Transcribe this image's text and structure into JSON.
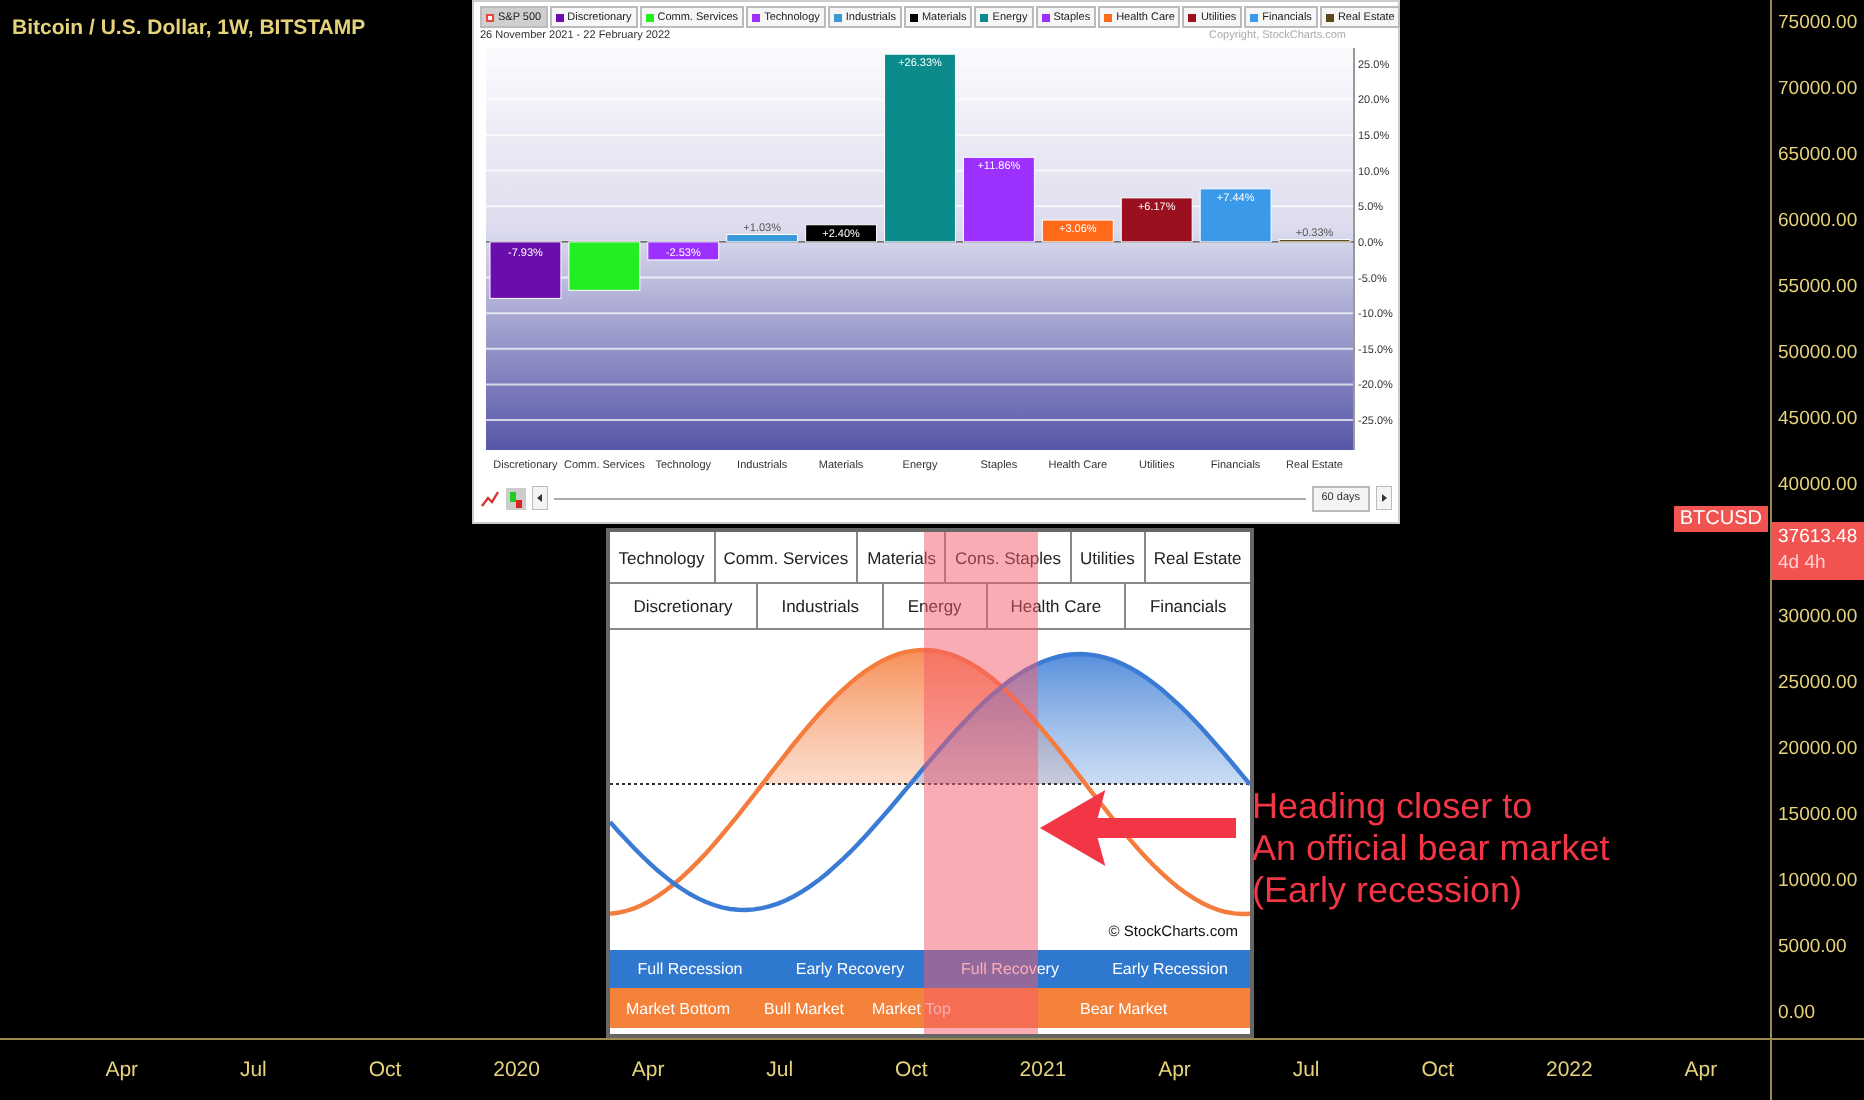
{
  "chart_title": "Bitcoin / U.S. Dollar, 1W, BITSTAMP",
  "sector_performance": {
    "legend": [
      {
        "label": "S&P 500",
        "color": "#e8453c",
        "selected": true
      },
      {
        "label": "Discretionary",
        "color": "#6a0dad",
        "selected": false
      },
      {
        "label": "Comm. Services",
        "color": "#22ee22",
        "selected": false
      },
      {
        "label": "Technology",
        "color": "#9b30ff",
        "selected": false
      },
      {
        "label": "Industrials",
        "color": "#3a9ad9",
        "selected": false
      },
      {
        "label": "Materials",
        "color": "#000000",
        "selected": false
      },
      {
        "label": "Energy",
        "color": "#0b8b8b",
        "selected": false
      },
      {
        "label": "Staples",
        "color": "#9b30ff",
        "selected": false
      },
      {
        "label": "Health Care",
        "color": "#ff6a1a",
        "selected": false
      },
      {
        "label": "Utilities",
        "color": "#9b1020",
        "selected": false
      },
      {
        "label": "Financials",
        "color": "#3a9ae9",
        "selected": false
      },
      {
        "label": "Real Estate",
        "color": "#5a4a1a",
        "selected": false
      }
    ],
    "date_range": "26 November 2021 - 22 February 2022",
    "copyright": "Copyright, StockCharts.com",
    "chart_data": {
      "type": "bar",
      "categories": [
        "Discretionary",
        "Comm. Services",
        "Technology",
        "Industrials",
        "Materials",
        "Energy",
        "Staples",
        "Health Care",
        "Utilities",
        "Financials",
        "Real Estate"
      ],
      "values": [
        -7.93,
        -6.8,
        -2.53,
        1.03,
        2.4,
        26.33,
        11.86,
        3.06,
        6.17,
        7.44,
        0.33
      ],
      "value_labels": [
        "-7.93%",
        null,
        "-2.53%",
        "+1.03%",
        "+2.40%",
        "+26.33%",
        "+11.86%",
        "+3.06%",
        "+6.17%",
        "+7.44%",
        "+0.33%"
      ],
      "ylim": [
        -29.2,
        27.2
      ],
      "grid": true,
      "yticks": [
        {
          "value": 25,
          "label": "25.0%"
        },
        {
          "value": 20,
          "label": "20.0%"
        },
        {
          "value": 15,
          "label": "15.0%"
        },
        {
          "value": 10,
          "label": "10.0%"
        },
        {
          "value": 5,
          "label": "5.0%"
        },
        {
          "value": 0,
          "label": "0.0%"
        },
        {
          "value": -5,
          "label": "-5.0%"
        },
        {
          "value": -10,
          "label": "-10.0%"
        },
        {
          "value": -15,
          "label": "-15.0%"
        },
        {
          "value": -20,
          "label": "-20.0%"
        },
        {
          "value": -25,
          "label": "-25.0%"
        }
      ]
    },
    "period": "60 days"
  },
  "sector_cycle": {
    "tab_rows": [
      [
        "Technology",
        "Comm. Services",
        "Materials",
        "Cons. Staples",
        "Utilities",
        "Real Estate"
      ],
      [
        "Discretionary",
        "Industrials",
        "Energy",
        "Health Care",
        "Financials"
      ]
    ],
    "copyright": "© StockCharts.com",
    "economy_phases": [
      "Full Recession",
      "Early Recovery",
      "Full Recovery",
      "Early Recession"
    ],
    "market_phases": [
      "Market Bottom",
      "Bull Market",
      "Market Top",
      "Bear Market"
    ]
  },
  "annotation": {
    "lines": [
      "Heading closer to",
      "An official bear market",
      "(Early recession)"
    ]
  },
  "price_axis": {
    "labels_above": [
      "75000.00",
      "70000.00",
      "65000.00",
      "60000.00",
      "55000.00",
      "50000.00",
      "45000.00",
      "40000.00"
    ],
    "labels_below": [
      "30000.00",
      "25000.00",
      "20000.00",
      "15000.00",
      "10000.00",
      "5000.00",
      "0.00"
    ],
    "symbol_tag": "BTCUSD",
    "last_price": "37613.48",
    "countdown": "4d 4h"
  },
  "time_axis": {
    "labels": [
      "Apr",
      "Jul",
      "Oct",
      "2020",
      "Apr",
      "Jul",
      "Oct",
      "2021",
      "Apr",
      "Jul",
      "Oct",
      "2022",
      "Apr"
    ]
  }
}
